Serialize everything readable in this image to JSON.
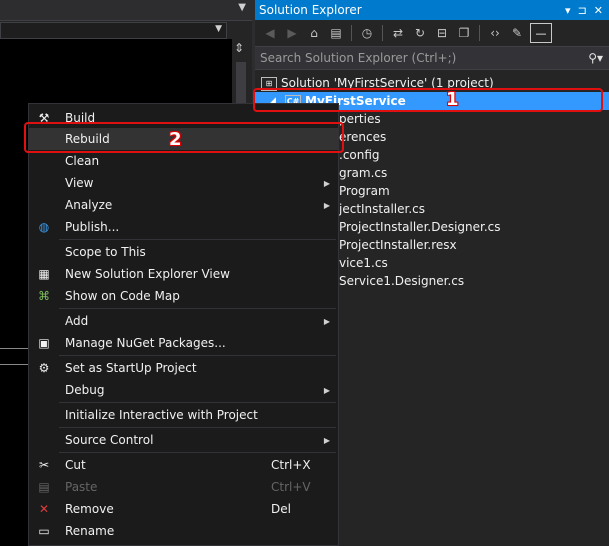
{
  "solution_explorer": {
    "title": "Solution Explorer",
    "title_controls": [
      "▾",
      "⊐",
      "✕"
    ],
    "search_placeholder": "Search Solution Explorer (Ctrl+;)",
    "tree": [
      {
        "label": "Solution 'MyFirstService' (1 project)",
        "icon": "solution-icon"
      },
      {
        "label": "MyFirstService",
        "icon": "csharp-project-icon",
        "selected": true
      },
      {
        "label": "perties"
      },
      {
        "label": "erences"
      },
      {
        "label": ".config"
      },
      {
        "label": "gram.cs"
      },
      {
        "label": "Program"
      },
      {
        "label": "jectInstaller.cs"
      },
      {
        "label": "ProjectInstaller.Designer.cs"
      },
      {
        "label": "ProjectInstaller.resx"
      },
      {
        "label": "vice1.cs"
      },
      {
        "label": "Service1.Designer.cs"
      }
    ]
  },
  "context_menu": {
    "items": [
      {
        "label": "Build",
        "icon": "build-icon"
      },
      {
        "label": "Rebuild"
      },
      {
        "label": "Clean"
      },
      {
        "label": "View",
        "submenu": true
      },
      {
        "label": "Analyze",
        "submenu": true
      },
      {
        "label": "Publish...",
        "icon": "globe-icon"
      },
      {
        "label": "Scope to This"
      },
      {
        "label": "New Solution Explorer View",
        "icon": "new-view-icon"
      },
      {
        "label": "Show on Code Map",
        "icon": "code-map-icon"
      },
      {
        "label": "Add",
        "submenu": true
      },
      {
        "label": "Manage NuGet Packages...",
        "icon": "nuget-icon"
      },
      {
        "label": "Set as StartUp Project",
        "icon": "gear-icon"
      },
      {
        "label": "Debug",
        "submenu": true
      },
      {
        "label": "Initialize Interactive with Project"
      },
      {
        "label": "Source Control",
        "submenu": true
      },
      {
        "label": "Cut",
        "shortcut": "Ctrl+X",
        "icon": "scissors-icon"
      },
      {
        "label": "Paste",
        "shortcut": "Ctrl+V",
        "icon": "paste-icon",
        "disabled": true
      },
      {
        "label": "Remove",
        "shortcut": "Del",
        "icon": "remove-icon"
      },
      {
        "label": "Rename",
        "icon": "rename-icon"
      }
    ]
  },
  "annotations": {
    "step1": "1",
    "step2": "2"
  },
  "colors": {
    "accent": "#007acc",
    "selection": "#3399ff",
    "callout": "#e01010"
  }
}
